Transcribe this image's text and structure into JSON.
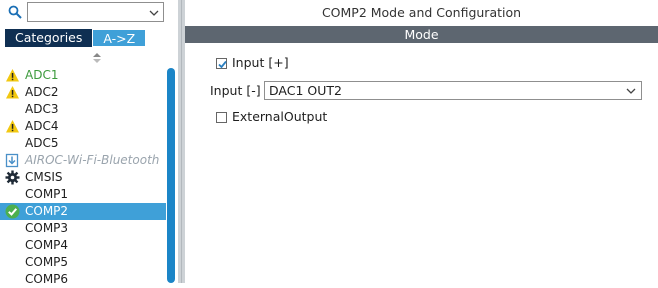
{
  "left": {
    "search": {
      "placeholder": ""
    },
    "tabs": [
      {
        "label": "Categories",
        "active": false
      },
      {
        "label": "A->Z",
        "active": true
      }
    ],
    "items": [
      {
        "label": "ADC1",
        "icon": "warning-icon",
        "state": "warning-ok"
      },
      {
        "label": "ADC2",
        "icon": "warning-icon",
        "state": "warning"
      },
      {
        "label": "ADC3",
        "icon": "",
        "state": "normal"
      },
      {
        "label": "ADC4",
        "icon": "warning-icon",
        "state": "warning"
      },
      {
        "label": "ADC5",
        "icon": "",
        "state": "normal"
      },
      {
        "label": "AIROC-Wi-Fi-Bluetooth",
        "icon": "download-icon",
        "state": "disabled"
      },
      {
        "label": "CMSIS",
        "icon": "gear-icon",
        "state": "normal"
      },
      {
        "label": "COMP1",
        "icon": "",
        "state": "normal"
      },
      {
        "label": "COMP2",
        "icon": "check-icon",
        "state": "selected"
      },
      {
        "label": "COMP3",
        "icon": "",
        "state": "normal"
      },
      {
        "label": "COMP4",
        "icon": "",
        "state": "normal"
      },
      {
        "label": "COMP5",
        "icon": "",
        "state": "normal"
      },
      {
        "label": "COMP6",
        "icon": "",
        "state": "normal"
      }
    ]
  },
  "right": {
    "title": "COMP2 Mode and Configuration",
    "mode_header": "Mode",
    "input_plus": {
      "label": "Input [+]",
      "checked": true
    },
    "input_minus": {
      "label": "Input [-]",
      "value": "DAC1 OUT2"
    },
    "external_output": {
      "label": "ExternalOutput",
      "checked": false
    }
  },
  "colors": {
    "accent": "#3fa0d8",
    "tab_bg": "#0f2f52",
    "mode_bar": "#5d6670",
    "warning": "#f2c811",
    "ok_green": "#3c9a3c"
  }
}
